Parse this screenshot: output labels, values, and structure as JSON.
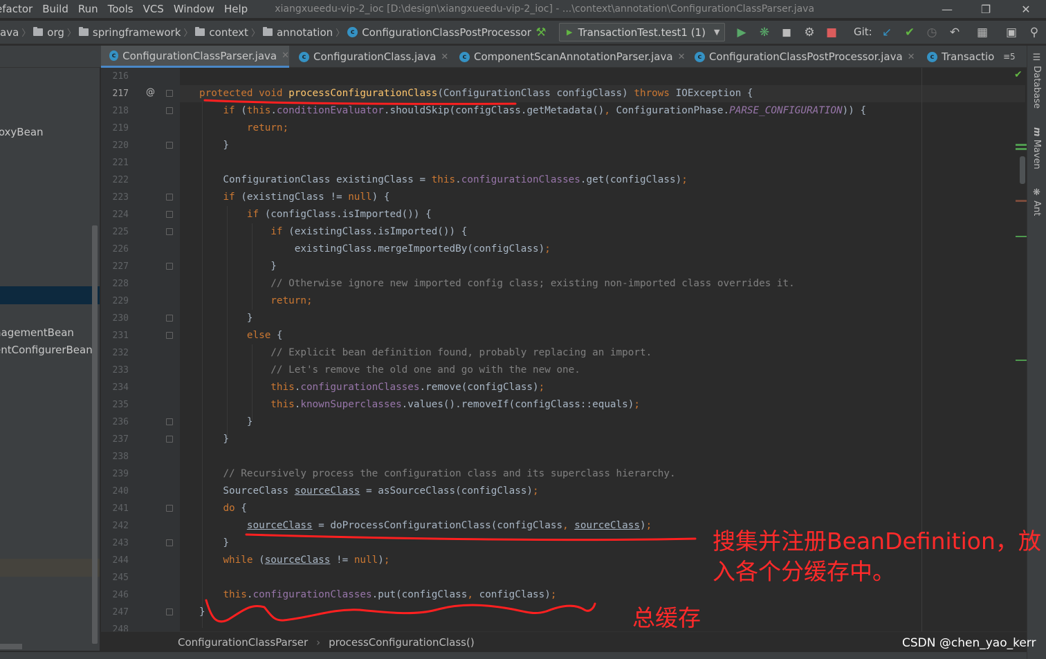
{
  "menu": {
    "items": [
      "efactor",
      "Build",
      "Run",
      "Tools",
      "VCS",
      "Window",
      "Help"
    ],
    "window_title": "xiangxueedu-vip-2_ioc [D:\\design\\xiangxueedu-vip-2_ioc] - ...\\context\\annotation\\ConfigurationClassParser.java"
  },
  "navbar": {
    "crumbs": [
      "ava",
      "org",
      "springframework",
      "context",
      "annotation",
      "ConfigurationClassPostProcessor"
    ],
    "run_config": "TransactionTest.test1 (1)",
    "git_label": "Git:"
  },
  "tabs": [
    {
      "label": "ConfigurationClassParser.java",
      "active": true
    },
    {
      "label": "ConfigurationClass.java",
      "active": false
    },
    {
      "label": "ComponentScanAnnotationParser.java",
      "active": false
    },
    {
      "label": "ConfigurationClassPostProcessor.java",
      "active": false
    },
    {
      "label": "Transactio",
      "active": false
    }
  ],
  "tab_overflow": "≡5",
  "project_panel": {
    "rows": [
      {
        "label": "roxyBean",
        "highlight": "none"
      },
      {
        "label": "",
        "highlight": "selected"
      },
      {
        "label": "nagementBean",
        "highlight": "none"
      },
      {
        "label": "entConfigurerBean",
        "highlight": "none"
      },
      {
        "label": "",
        "highlight": "muted"
      }
    ]
  },
  "line_numbers": [
    "216",
    "217",
    "218",
    "219",
    "220",
    "221",
    "222",
    "223",
    "224",
    "225",
    "226",
    "227",
    "228",
    "229",
    "230",
    "231",
    "232",
    "233",
    "234",
    "235",
    "236",
    "237",
    "238",
    "239",
    "240",
    "241",
    "242",
    "243",
    "244",
    "245",
    "246",
    "247",
    "248"
  ],
  "code_lines": [
    [],
    [
      [
        "protected",
        "kw"
      ],
      [
        " "
      ],
      [
        "void",
        "kw"
      ],
      [
        " "
      ],
      [
        "processConfigurationClass",
        "fn"
      ],
      [
        "(ConfigurationClass configClass) "
      ],
      [
        "throws",
        "kw"
      ],
      [
        " IOException {"
      ]
    ],
    [
      [
        "    "
      ],
      [
        "if",
        "kw"
      ],
      [
        " ("
      ],
      [
        "this",
        "kw"
      ],
      [
        "."
      ],
      [
        "conditionEvaluator",
        "fld"
      ],
      [
        ".shouldSkip(configClass.getMetadata()"
      ],
      [
        ",",
        "kw"
      ],
      [
        " ConfigurationPhase."
      ],
      [
        "PARSE_CONFIGURATION",
        "const"
      ],
      [
        ")) {"
      ]
    ],
    [
      [
        "        "
      ],
      [
        "return",
        "kw"
      ],
      [
        ";",
        "kw"
      ]
    ],
    [
      [
        "    }"
      ]
    ],
    [],
    [
      [
        "    ConfigurationClass existingClass = "
      ],
      [
        "this",
        "kw"
      ],
      [
        "."
      ],
      [
        "configurationClasses",
        "fld"
      ],
      [
        ".get(configClass)"
      ],
      [
        ";",
        "kw"
      ]
    ],
    [
      [
        "    "
      ],
      [
        "if",
        "kw"
      ],
      [
        " (existingClass != "
      ],
      [
        "null",
        "kw"
      ],
      [
        ") {"
      ]
    ],
    [
      [
        "        "
      ],
      [
        "if",
        "kw"
      ],
      [
        " (configClass.isImported()) {"
      ]
    ],
    [
      [
        "            "
      ],
      [
        "if",
        "kw"
      ],
      [
        " (existingClass.isImported()) {"
      ]
    ],
    [
      [
        "                existingClass.mergeImportedBy(configClass)"
      ],
      [
        ";",
        "kw"
      ]
    ],
    [
      [
        "            }"
      ]
    ],
    [
      [
        "            "
      ],
      [
        "// Otherwise ignore new imported config class; existing non-imported class overrides it.",
        "cmt"
      ]
    ],
    [
      [
        "            "
      ],
      [
        "return",
        "kw"
      ],
      [
        ";",
        "kw"
      ]
    ],
    [
      [
        "        }"
      ]
    ],
    [
      [
        "        "
      ],
      [
        "else",
        "kw"
      ],
      [
        " {"
      ]
    ],
    [
      [
        "            "
      ],
      [
        "// Explicit bean definition found, probably replacing an import.",
        "cmt"
      ]
    ],
    [
      [
        "            "
      ],
      [
        "// Let's remove the old one and go with the new one.",
        "cmt"
      ]
    ],
    [
      [
        "            "
      ],
      [
        "this",
        "kw"
      ],
      [
        "."
      ],
      [
        "configurationClasses",
        "fld"
      ],
      [
        ".remove(configClass)"
      ],
      [
        ";",
        "kw"
      ]
    ],
    [
      [
        "            "
      ],
      [
        "this",
        "kw"
      ],
      [
        "."
      ],
      [
        "knownSuperclasses",
        "fld"
      ],
      [
        ".values().removeIf(configClass::equals)"
      ],
      [
        ";",
        "kw"
      ]
    ],
    [
      [
        "        }"
      ]
    ],
    [
      [
        "    }"
      ]
    ],
    [],
    [
      [
        "    "
      ],
      [
        "// Recursively process the configuration class and its superclass hierarchy.",
        "cmt"
      ]
    ],
    [
      [
        "    SourceClass "
      ],
      [
        "sourceClass",
        "ul"
      ],
      [
        " = asSourceClass(configClass)"
      ],
      [
        ";",
        "kw"
      ]
    ],
    [
      [
        "    "
      ],
      [
        "do",
        "kw"
      ],
      [
        " {"
      ]
    ],
    [
      [
        "        "
      ],
      [
        "sourceClass",
        "ul"
      ],
      [
        " = doProcessConfigurationClass(configClass"
      ],
      [
        ",",
        "kw"
      ],
      [
        " "
      ],
      [
        "sourceClass",
        "ul"
      ],
      [
        ")"
      ],
      [
        ";",
        "kw"
      ]
    ],
    [
      [
        "    }"
      ]
    ],
    [
      [
        "    "
      ],
      [
        "while",
        "kw"
      ],
      [
        " ("
      ],
      [
        "sourceClass",
        "ul"
      ],
      [
        " != "
      ],
      [
        "null",
        "kw"
      ],
      [
        ")"
      ],
      [
        ";",
        "kw"
      ]
    ],
    [],
    [
      [
        "    "
      ],
      [
        "this",
        "kw"
      ],
      [
        "."
      ],
      [
        "configurationClasses",
        "fld"
      ],
      [
        ".put(configClass"
      ],
      [
        ",",
        "kw"
      ],
      [
        " configClass)"
      ],
      [
        ";",
        "kw"
      ]
    ],
    [
      [
        "}"
      ]
    ],
    []
  ],
  "breadcrumb": [
    "ConfigurationClassParser",
    "processConfigurationClass()"
  ],
  "right_sidebar": [
    "Database",
    "Maven",
    "Ant"
  ],
  "annotations": {
    "note_1_line1": "搜集并注册BeanDefinition，放",
    "note_1_line2": "入各个分缓存中。",
    "note_2": "总缓存"
  },
  "watermark": "CSDN @chen_yao_kerr",
  "colors": {
    "keyword": "#cc7832",
    "field": "#9876aa",
    "method": "#ffc66d",
    "comment": "#808080",
    "annotation_red": "#ff2a2a",
    "accent_blue": "#4a88c7"
  }
}
